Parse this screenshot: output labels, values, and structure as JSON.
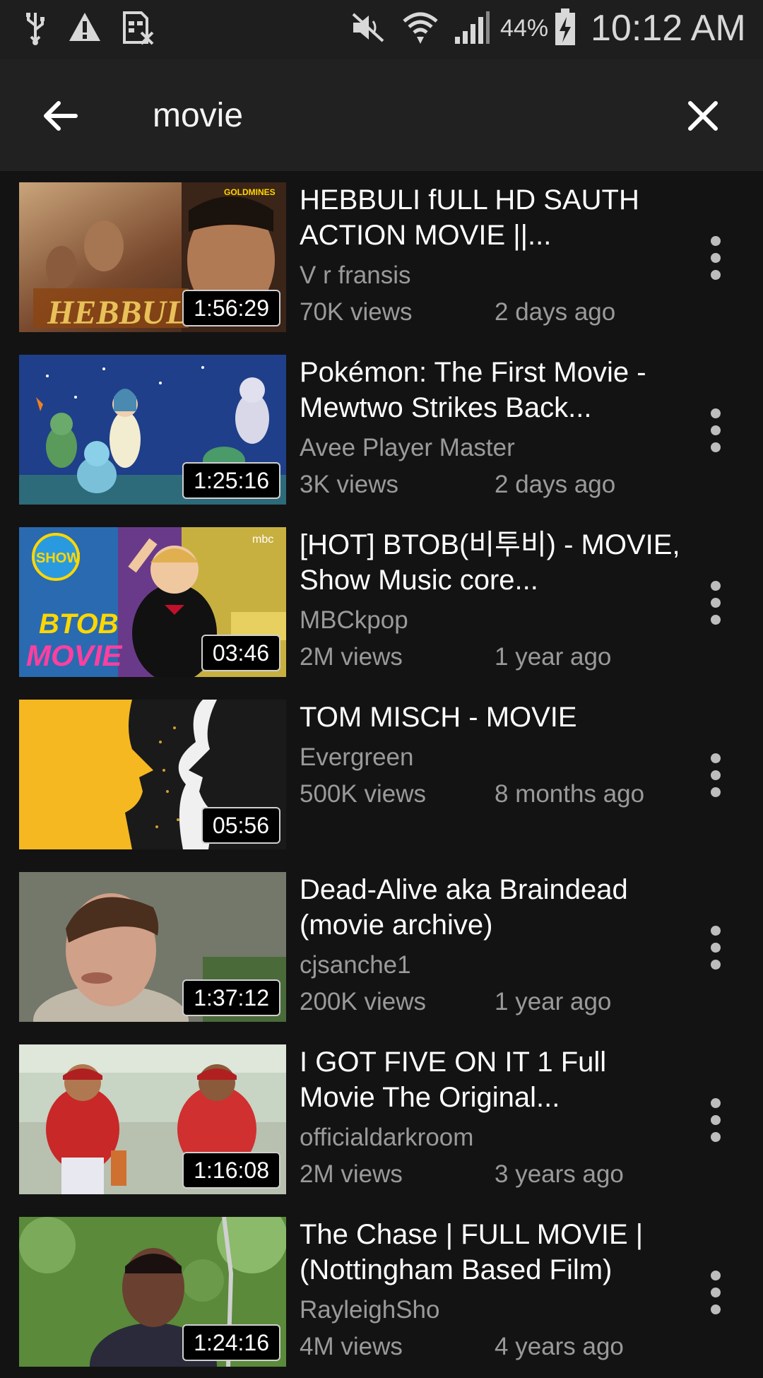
{
  "status_bar": {
    "icons": [
      "usb-icon",
      "warning-icon",
      "no-sim-icon",
      "mute-icon",
      "wifi-icon",
      "signal-icon",
      "battery-icon"
    ],
    "battery": "44%",
    "time": "10:12 AM"
  },
  "search": {
    "query": "movie",
    "back_icon": "arrow-back-icon",
    "clear_icon": "close-icon"
  },
  "results": [
    {
      "title": "HEBBULI fULL HD SAUTH ACTION MOVIE ||...",
      "channel": "V r fransis",
      "views": "70K views",
      "age": "2 days ago",
      "duration": "1:56:29"
    },
    {
      "title": "Pokémon: The First Movie - Mewtwo Strikes Back...",
      "channel": "Avee Player Master",
      "views": "3K views",
      "age": "2 days ago",
      "duration": "1:25:16"
    },
    {
      "title": "[HOT] BTOB(비투비) - MOVIE, Show Music core...",
      "channel": "MBCkpop",
      "views": "2M views",
      "age": "1 year ago",
      "duration": "03:46"
    },
    {
      "title": "TOM MISCH - MOVIE",
      "channel": "Evergreen",
      "views": "500K views",
      "age": "8 months ago",
      "duration": "05:56"
    },
    {
      "title": "Dead-Alive aka Braindead (movie archive)",
      "channel": "cjsanche1",
      "views": "200K views",
      "age": "1 year ago",
      "duration": "1:37:12"
    },
    {
      "title": "I GOT FIVE ON IT 1 Full Movie The Original...",
      "channel": "officialdarkroom",
      "views": "2M views",
      "age": "3 years ago",
      "duration": "1:16:08"
    },
    {
      "title": "The Chase | FULL MOVIE | (Nottingham Based Film)",
      "channel": "RayleighSho",
      "views": "4M views",
      "age": "4 years ago",
      "duration": "1:24:16"
    }
  ],
  "thumb_text": {
    "t1_logo": "GOLDMINES",
    "t1_word": "HEBBULI",
    "t3_badge": "SHOW",
    "t3_word1": "BTOB",
    "t3_word2": "MOVIE",
    "t3_mbc": "mbc"
  },
  "colors": {
    "background": "#131313",
    "appbar": "#212121",
    "text_primary": "#ffffff",
    "text_secondary": "#9a9a9a"
  }
}
